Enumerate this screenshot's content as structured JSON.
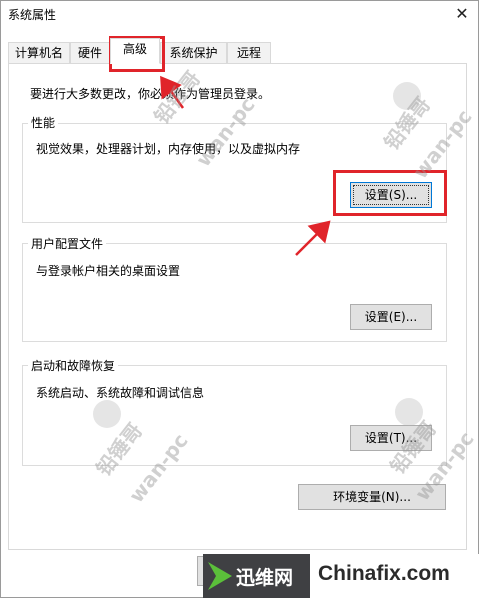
{
  "window": {
    "title": "系统属性",
    "close_glyph": "✕"
  },
  "tabs": [
    {
      "label": "计算机名"
    },
    {
      "label": "硬件"
    },
    {
      "label": "高级",
      "active": true
    },
    {
      "label": "系统保护"
    },
    {
      "label": "远程"
    }
  ],
  "notice": "要进行大多数更改，你必须作为管理员登录。",
  "groups": {
    "performance": {
      "title": "性能",
      "desc": "视觉效果，处理器计划，内存使用，以及虚拟内存",
      "button": "设置(S)..."
    },
    "user_profiles": {
      "title": "用户配置文件",
      "desc": "与登录帐户相关的桌面设置",
      "button": "设置(E)..."
    },
    "startup_recovery": {
      "title": "启动和故障恢复",
      "desc": "系统启动、系统故障和调试信息",
      "button": "设置(T)..."
    }
  },
  "env_button": "环境变量(N)...",
  "watermarks": {
    "cn": "铅锤哥",
    "en": "wan-pc"
  },
  "footer": {
    "brand_cn": "迅维网",
    "brand_site": "Chinafix.com"
  },
  "colors": {
    "highlight": "#e0242a",
    "button_bg": "#e1e1e1",
    "focus_border": "#0078d7"
  }
}
